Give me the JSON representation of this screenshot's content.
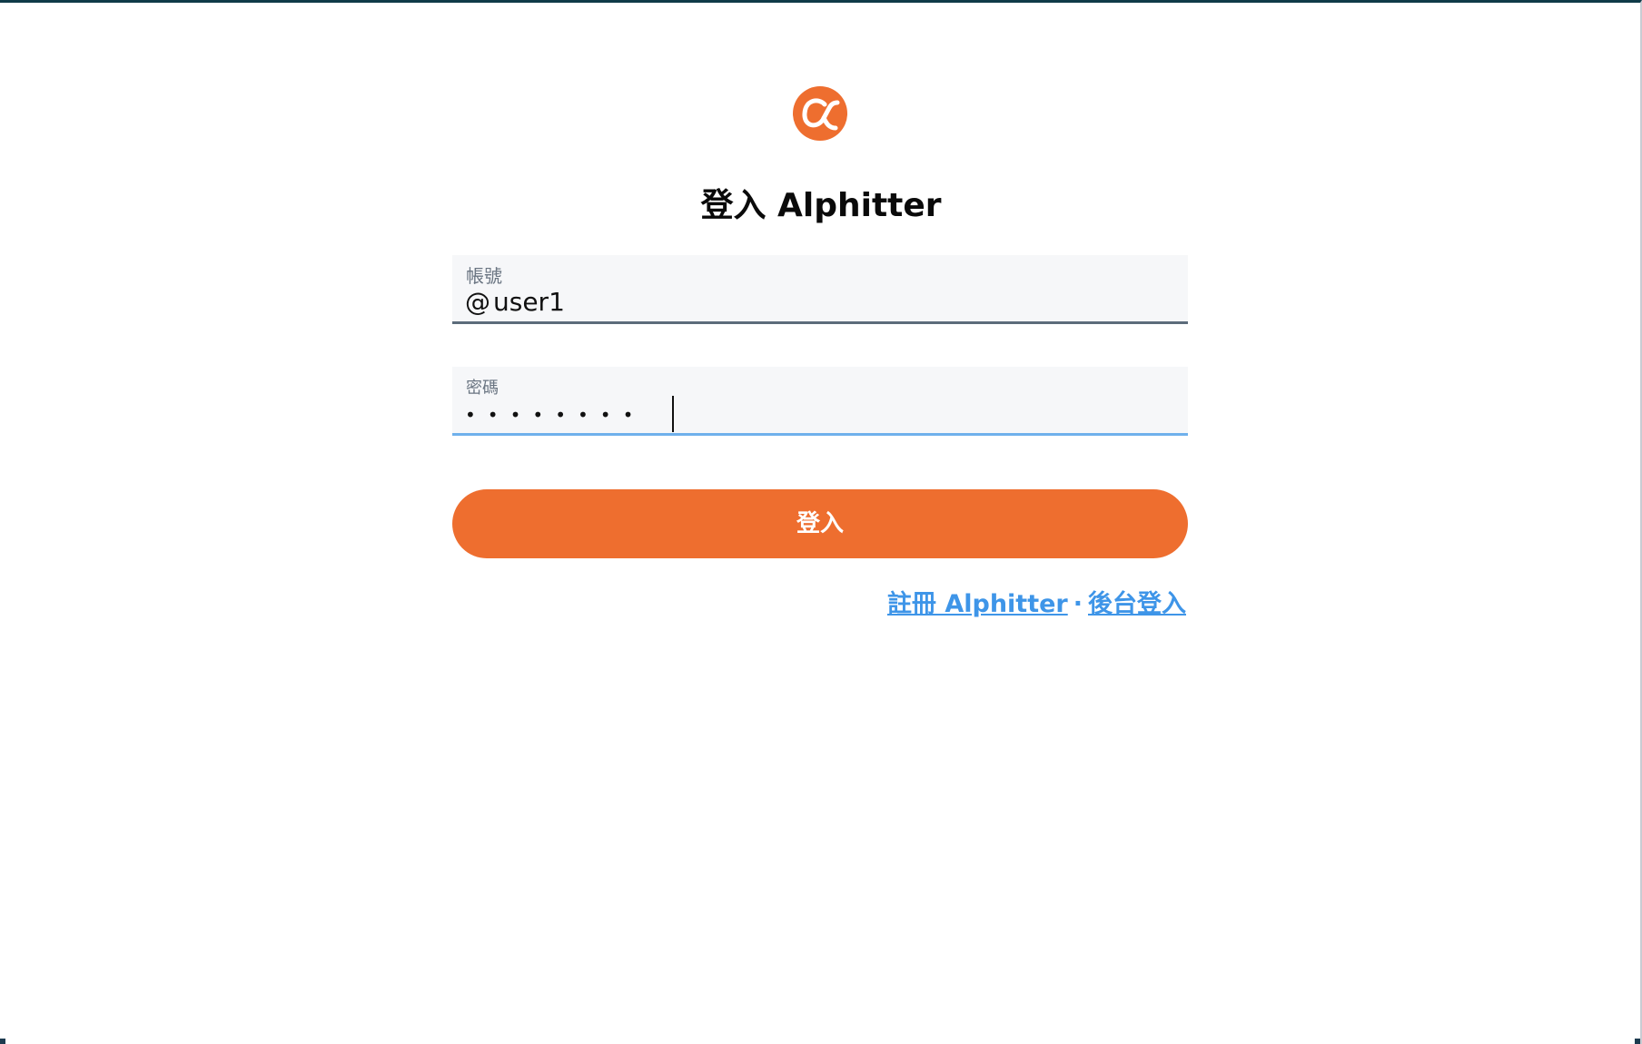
{
  "page": {
    "title": "登入 Alphitter"
  },
  "brand": {
    "logo_icon": "alpha-logo-icon",
    "accent_color": "#ee6e2f",
    "link_color": "#3e95e8"
  },
  "form": {
    "username": {
      "label": "帳號",
      "prefix": "@",
      "value": "user1"
    },
    "password": {
      "label": "密碼",
      "masked_value": "••••••••"
    },
    "submit_label": "登入"
  },
  "links": {
    "register_label": "註冊 Alphitter",
    "separator": "·",
    "admin_login_label": "後台登入"
  }
}
